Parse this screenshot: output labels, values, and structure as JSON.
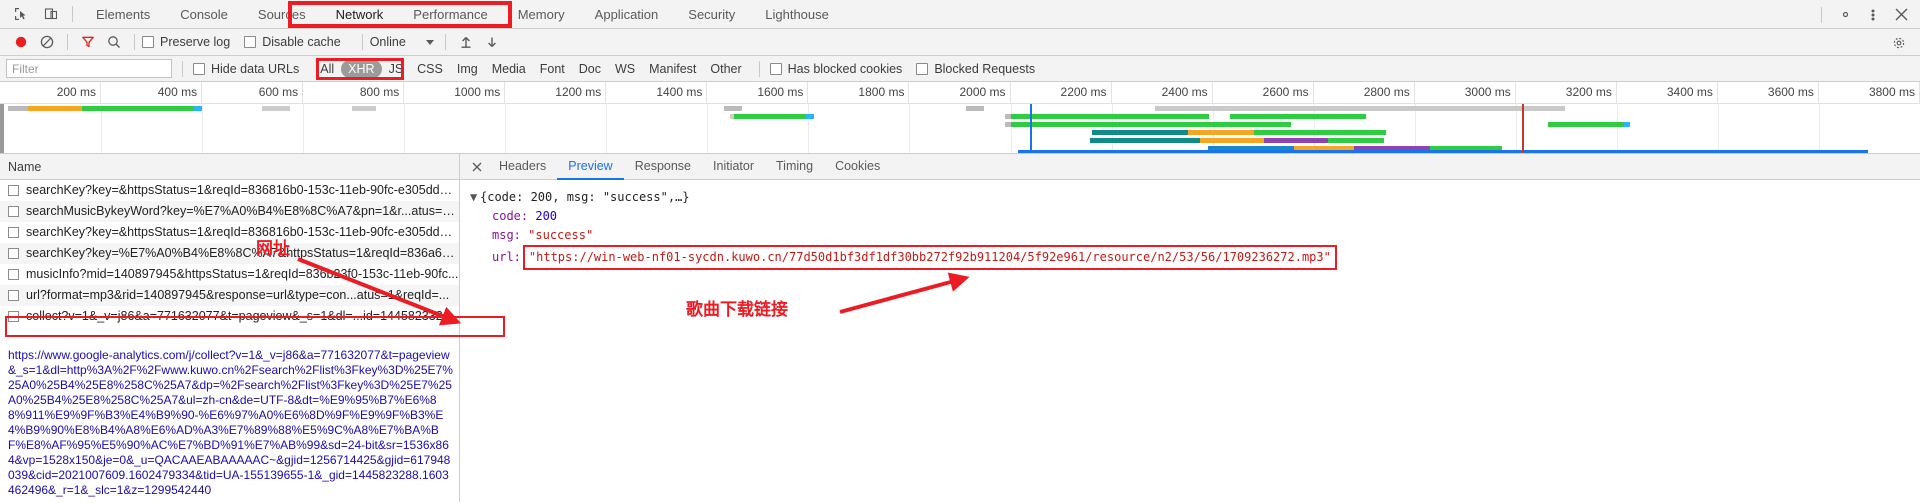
{
  "tabbar": {
    "icons": [
      {
        "name": "inspect-element-icon"
      },
      {
        "name": "device-toolbar-icon"
      }
    ],
    "tabs": [
      {
        "label": "Elements",
        "active": false
      },
      {
        "label": "Console",
        "active": false
      },
      {
        "label": "Sources",
        "active": false
      },
      {
        "label": "Network",
        "active": true
      },
      {
        "label": "Performance",
        "active": false
      },
      {
        "label": "Memory",
        "active": false
      },
      {
        "label": "Application",
        "active": false
      },
      {
        "label": "Security",
        "active": false
      },
      {
        "label": "Lighthouse",
        "active": false
      }
    ],
    "right_icons": [
      {
        "name": "settings-gear-icon"
      },
      {
        "name": "more-options-kebab-icon"
      },
      {
        "name": "close-devtools-icon"
      }
    ]
  },
  "network_toolbar": {
    "record_button": "record-button",
    "clear_button": "clear-button",
    "filter_button": "filter-funnel-button",
    "search_button": "search-button",
    "preserve_log_label": "Preserve log",
    "preserve_log_checked": false,
    "disable_cache_label": "Disable cache",
    "disable_cache_checked": false,
    "throttling_value": "Online",
    "import_har_icon": "import-har-icon",
    "export_har_icon": "export-har-icon",
    "settings_icon": "network-settings-gear-icon"
  },
  "filter_row": {
    "filter_placeholder": "Filter",
    "filter_value": "",
    "hide_data_urls_label": "Hide data URLs",
    "hide_data_urls_checked": false,
    "types": [
      {
        "label": "All",
        "selected": false
      },
      {
        "label": "XHR",
        "selected": true
      },
      {
        "label": "JS",
        "selected": false
      },
      {
        "label": "CSS",
        "selected": false
      },
      {
        "label": "Img",
        "selected": false
      },
      {
        "label": "Media",
        "selected": false
      },
      {
        "label": "Font",
        "selected": false
      },
      {
        "label": "Doc",
        "selected": false
      },
      {
        "label": "WS",
        "selected": false
      },
      {
        "label": "Manifest",
        "selected": false
      },
      {
        "label": "Other",
        "selected": false
      }
    ],
    "has_blocked_cookies_label": "Has blocked cookies",
    "has_blocked_cookies_checked": false,
    "blocked_requests_label": "Blocked Requests",
    "blocked_requests_checked": false
  },
  "timeline": {
    "ticks": [
      "200 ms",
      "400 ms",
      "600 ms",
      "800 ms",
      "1000 ms",
      "1200 ms",
      "1400 ms",
      "1600 ms",
      "1800 ms",
      "2000 ms",
      "2200 ms",
      "2400 ms",
      "2600 ms",
      "2800 ms",
      "3000 ms",
      "3200 ms",
      "3400 ms",
      "3600 ms",
      "3800 ms"
    ],
    "tick_interval_ms": 200,
    "dom_content_loaded_color": "#1a73e8",
    "load_event_color": "#c0392b"
  },
  "request_list": {
    "header": "Name",
    "rows": [
      {
        "name": "searchKey?key=&httpsStatus=1&reqId=836816b0-153c-11eb-90fc-e305dda1..."
      },
      {
        "name": "searchMusicBykeyWord?key=%E7%A0%B4%E8%8C%A7&pn=1&r...atus=1&r..."
      },
      {
        "name": "searchKey?key=&httpsStatus=1&reqId=836816b0-153c-11eb-90fc-e305dda1..."
      },
      {
        "name": "searchKey?key=%E7%A0%B4%E8%8C%A7&httpsStatus=1&reqId=836a60a0-..."
      },
      {
        "name": "musicInfo?mid=140897945&httpsStatus=1&reqId=836b23f0-153c-11eb-90fc..."
      },
      {
        "name": "url?format=mp3&rid=140897945&response=url&type=con...atus=1&reqId=..."
      },
      {
        "name": "collect?v=1&_v=j86&a=771632077&t=pageview&_s=1&dl=...id=144582332..."
      }
    ],
    "selected_index": 6
  },
  "details": {
    "tabs": [
      {
        "label": "Headers",
        "active": false
      },
      {
        "label": "Preview",
        "active": true
      },
      {
        "label": "Response",
        "active": false
      },
      {
        "label": "Initiator",
        "active": false
      },
      {
        "label": "Timing",
        "active": false
      },
      {
        "label": "Cookies",
        "active": false
      }
    ],
    "preview": {
      "root_line": "{code: 200, msg: \"success\",…}",
      "code_key": "code:",
      "code_value": "200",
      "msg_key": "msg:",
      "msg_value": "\"success\"",
      "url_key": "url:",
      "url_value": "\"https://win-web-nf01-sycdn.kuwo.cn/77d50d1bf3df1df30bb272f92b911204/5f92e961/resource/n2/53/56/1709236272.mp3\""
    }
  },
  "bottom_url": {
    "text": "https://www.google-analytics.com/j/collect?v=1&_v=j86&a=771632077&t=pageview&_s=1&dl=http%3A%2F%2Fwww.kuwo.cn%2Fsearch%2Flist%3Fkey%3D%25E7%25A0%25B4%25E8%258C%25A7&dp=%2Fsearch%2Flist%3Fkey%3D%25E7%25A0%25B4%25E8%258C%25A7&ul=zh-cn&de=UTF-8&dt=%E9%95%B7%E6%88%911%E9%9F%B3%E4%B9%90-%E6%97%A0%E6%8D%9F%E9%9F%B3%E4%B9%90%E8%B4%A8%E6%AD%A3%E7%89%88%E5%9C%A8%E7%BA%BF%E8%AF%95%E5%90%AC%E7%BD%91%E7%AB%99&sd=24-bit&sr=1536x864&vp=1528x150&je=0&_u=QACAAEABAAAAAC~&gjid=1256714425&gjid=617948039&cid=2021007609.1602479334&tid=UA-155139655-1&_gid=1445823288.1603462496&_r=1&_slc=1&z=1299542440"
  },
  "annotations": [
    {
      "name": "url-annotation-label",
      "text": "网址",
      "color": "#cc0000"
    },
    {
      "name": "song-download-link-annotation-label",
      "text": "歌曲下载链接",
      "color": "#ec1c24"
    }
  ],
  "colors": {
    "accent_blue": "#1a73e8",
    "annotation_red": "#ec1c24",
    "selected_pill_bg": "#9b9b9b",
    "toolbar_bg": "#f3f3f3",
    "string_red": "#c41a16",
    "number_blue": "#1c00cf",
    "prop_purple": "#881391"
  }
}
